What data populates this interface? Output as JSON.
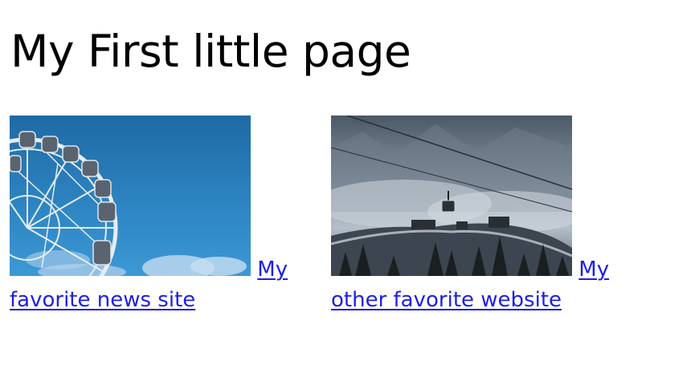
{
  "page": {
    "title": "My First little page"
  },
  "links": [
    {
      "text": "My favorite news site",
      "image_alt": "Ferris wheel against a blue sky"
    },
    {
      "text": "My other favorite website",
      "image_alt": "Cable car above a snowy mountain ridge"
    }
  ],
  "colors": {
    "link": "#1d1ee8",
    "text": "#000000",
    "background": "#ffffff"
  }
}
